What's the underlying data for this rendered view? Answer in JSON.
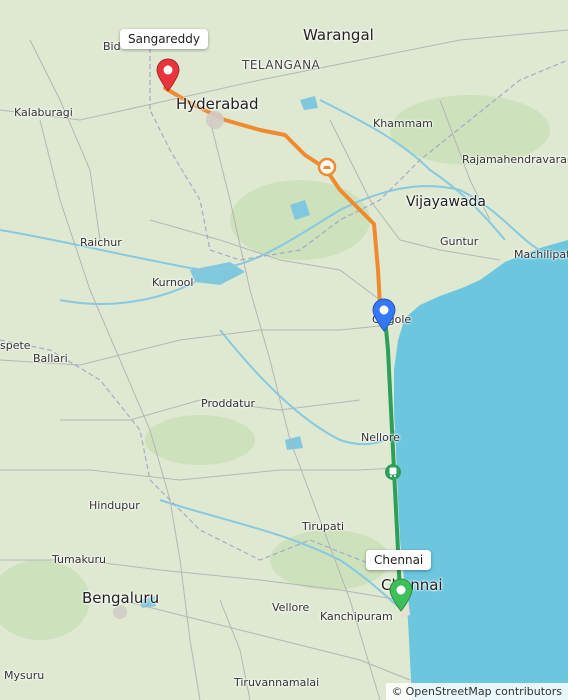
{
  "map": {
    "cities": [
      {
        "name": "Warangal",
        "size": "big"
      },
      {
        "name": "TELANGANA",
        "size": "region"
      },
      {
        "name": "Hyderabad",
        "size": "big"
      },
      {
        "name": "Bid",
        "size": "small"
      },
      {
        "name": "Kalaburagi",
        "size": "small"
      },
      {
        "name": "Khammam",
        "size": "small"
      },
      {
        "name": "Rajamahendravaram",
        "size": "small"
      },
      {
        "name": "Vijayawada",
        "size": "med"
      },
      {
        "name": "Guntur",
        "size": "small"
      },
      {
        "name": "Machilipatnam",
        "size": "small"
      },
      {
        "name": "Raichur",
        "size": "small"
      },
      {
        "name": "Kurnool",
        "size": "small"
      },
      {
        "name": "Ongole",
        "size": "small"
      },
      {
        "name": "spete",
        "size": "small"
      },
      {
        "name": "Ballari",
        "size": "small"
      },
      {
        "name": "Proddatur",
        "size": "small"
      },
      {
        "name": "Nellore",
        "size": "small"
      },
      {
        "name": "Hindupur",
        "size": "small"
      },
      {
        "name": "Tirupati",
        "size": "small"
      },
      {
        "name": "Tumakuru",
        "size": "small"
      },
      {
        "name": "Bengaluru",
        "size": "big"
      },
      {
        "name": "Chennai",
        "size": "big"
      },
      {
        "name": "Vellore",
        "size": "small"
      },
      {
        "name": "Kanchipuram",
        "size": "small"
      },
      {
        "name": "Mysuru",
        "size": "small"
      },
      {
        "name": "Tiruvannamalai",
        "size": "small"
      }
    ],
    "markers": {
      "start": {
        "label": "Sangareddy",
        "color": "#e8353b"
      },
      "waypoint": {
        "color": "#3478f6"
      },
      "end": {
        "label": "Chennai",
        "color": "#3fbf5a"
      }
    },
    "routes": {
      "road_color": "#f08a2e",
      "rail_color": "#2e9e5b",
      "water_color": "#6cc6de"
    },
    "attribution": {
      "symbol": "©",
      "text": "OpenStreetMap contributors"
    }
  }
}
